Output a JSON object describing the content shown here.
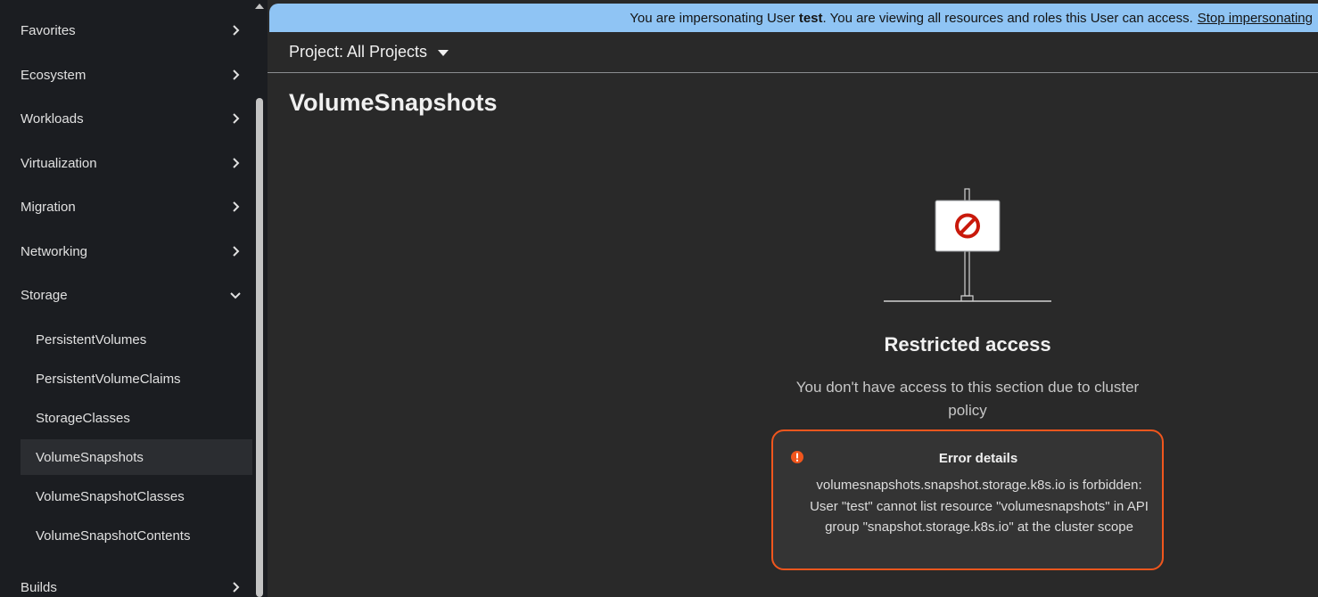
{
  "sidebar": {
    "items": [
      {
        "label": "Favorites",
        "expanded": false
      },
      {
        "label": "Ecosystem",
        "expanded": false
      },
      {
        "label": "Workloads",
        "expanded": false
      },
      {
        "label": "Virtualization",
        "expanded": false
      },
      {
        "label": "Migration",
        "expanded": false
      },
      {
        "label": "Networking",
        "expanded": false
      },
      {
        "label": "Storage",
        "expanded": true
      },
      {
        "label": "Builds",
        "expanded": false
      }
    ],
    "storage_children": [
      {
        "label": "PersistentVolumes",
        "active": false
      },
      {
        "label": "PersistentVolumeClaims",
        "active": false
      },
      {
        "label": "StorageClasses",
        "active": false
      },
      {
        "label": "VolumeSnapshots",
        "active": true
      },
      {
        "label": "VolumeSnapshotClasses",
        "active": false
      },
      {
        "label": "VolumeSnapshotContents",
        "active": false
      }
    ]
  },
  "banner": {
    "prefix": "You are impersonating User",
    "user": "test",
    "suffix": ". You are viewing all resources and roles this User can access.",
    "stop_link": "Stop impersonating"
  },
  "project": {
    "label": "Project: All Projects"
  },
  "page": {
    "title": "VolumeSnapshots"
  },
  "empty_state": {
    "icon": "ban-sign-icon",
    "title": "Restricted access",
    "body": "You don't have access to this section due to cluster policy"
  },
  "error": {
    "title": "Error details",
    "message": "volumesnapshots.snapshot.storage.k8s.io is forbidden: User \"test\" cannot list resource \"volumesnapshots\" in API group \"snapshot.storage.k8s.io\" at the cluster scope"
  },
  "colors": {
    "banner_bg": "#8fc4f4",
    "error_border": "#f0561d",
    "ban_red": "#c9190b",
    "main_bg": "#292929",
    "sidebar_bg": "#1b1d21"
  }
}
